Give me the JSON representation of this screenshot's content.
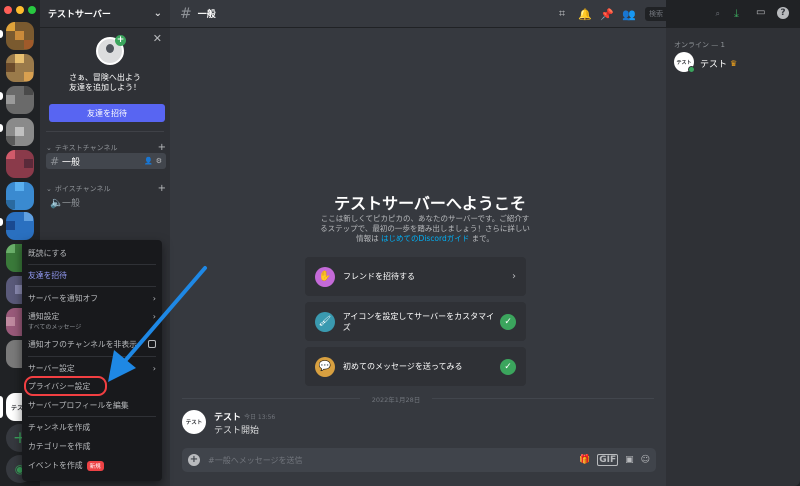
{
  "window": {
    "title": "テストサーバー"
  },
  "server": {
    "name": "テストサーバー"
  },
  "invite_card": {
    "line1": "さぁ、冒険へ出よう",
    "line2": "友達を追加しよう！",
    "button": "友達を招待"
  },
  "channels": {
    "text_category": "テキストチャンネル",
    "voice_category": "ボイスチャンネル",
    "text_items": [
      {
        "name": "一般"
      }
    ],
    "voice_items": [
      {
        "name": "一般"
      }
    ]
  },
  "topbar": {
    "channel": "一般",
    "search_placeholder": "検索"
  },
  "welcome": {
    "title": "テストサーバーへようこそ",
    "desc1": "ここは新しくてピカピカの、あなたのサーバーです。ご紹介す",
    "desc2": "るステップで、最初の一歩を踏み出しましょう！さらに詳しい",
    "desc3_pre": "情報は",
    "desc3_link": "はじめてのDiscordガイド",
    "desc3_post": "まで。",
    "tasks": [
      {
        "label": "フレンドを招待する"
      },
      {
        "label": "アイコンを設定してサーバーをカスタマイズ"
      },
      {
        "label": "初めてのメッセージを送ってみる"
      }
    ]
  },
  "messages": {
    "date": "2022年1月28日",
    "author": "テスト",
    "time": "今日 13:56",
    "content": "テスト開始",
    "avatar_text": "テスト"
  },
  "composer": {
    "placeholder": "#一般へメッセージを送信"
  },
  "members": {
    "header": "オンライン — 1",
    "name": "テスト",
    "avatar_text": "テスト"
  },
  "context_menu": {
    "mark_read": "既読にする",
    "invite": "友達を招待",
    "mute_server": "サーバーを通知オフ",
    "notify_settings": "通知設定",
    "notify_sub": "すべてのメッセージ",
    "hide_muted": "通知オフのチャンネルを非表示",
    "server_settings": "サーバー設定",
    "privacy": "プライバシー設定",
    "edit_profile": "サーバープロフィールを編集",
    "create_channel": "チャンネルを作成",
    "create_category": "カテゴリーを作成",
    "create_event": "イベントを作成",
    "new_badge": "新規"
  },
  "guild_rail": {
    "selected_text": "テスト"
  },
  "colors": {
    "accent": "#5865f2",
    "green": "#3ba55d",
    "highlight": "#f23f42",
    "arrow": "#1e88e5"
  },
  "icons": [
    "threads-icon",
    "bell-icon",
    "pin-icon",
    "members-icon",
    "search-icon",
    "download-icon",
    "inbox-icon",
    "help-icon"
  ]
}
